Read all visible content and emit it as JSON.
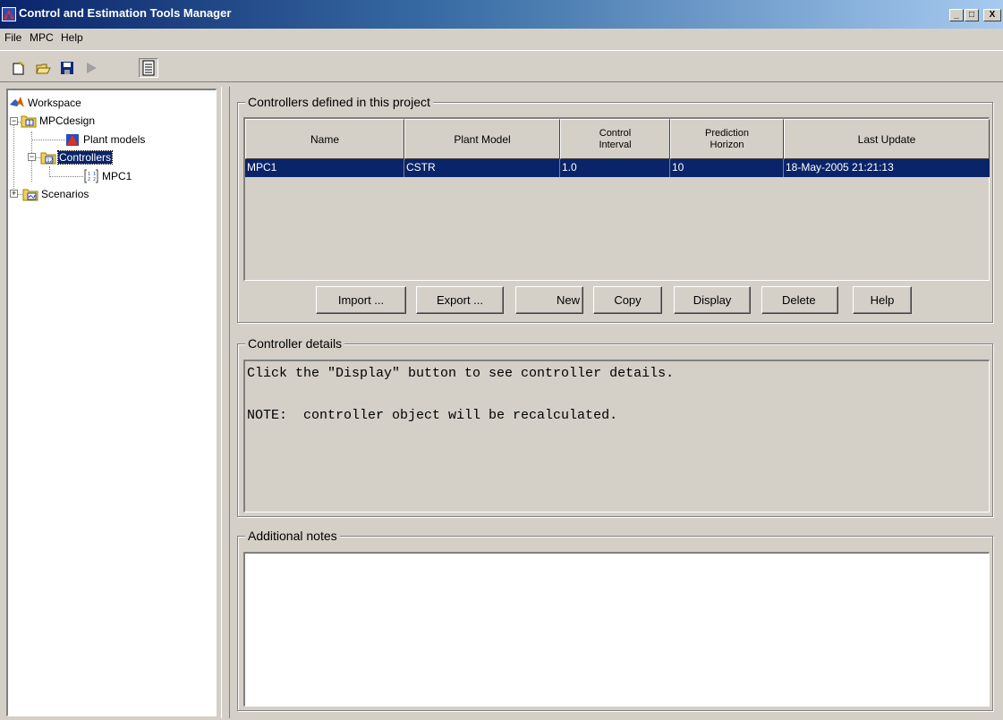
{
  "window": {
    "title": "Control and Estimation Tools Manager",
    "buttons": {
      "minimize": "_",
      "maximize": "□",
      "close": "X"
    }
  },
  "menu": [
    "File",
    "MPC",
    "Help"
  ],
  "toolbar": {
    "icons": [
      "new-icon",
      "open-icon",
      "save-icon",
      "run-icon",
      "notes-icon"
    ]
  },
  "tree": {
    "nodes": [
      {
        "label": "Workspace",
        "icon": "matlab-icon"
      },
      {
        "label": "MPCdesign",
        "icon": "project-icon",
        "expander": "−"
      },
      {
        "label": "Plant models",
        "icon": "plant-icon"
      },
      {
        "label": "Controllers",
        "icon": "controllers-icon",
        "expander": "−",
        "selected": true
      },
      {
        "label": "MPC1",
        "icon": "controller-icon"
      },
      {
        "label": "Scenarios",
        "icon": "scenarios-icon",
        "expander": "+"
      }
    ]
  },
  "controllers": {
    "title": "Controllers defined in this project",
    "columns": [
      "Name",
      "Plant Model",
      "Control\nInterval",
      "Prediction\nHorizon",
      "Last Update"
    ],
    "rows": [
      [
        "MPC1",
        "CSTR",
        "1.0",
        "10",
        "18-May-2005 21:21:13"
      ]
    ],
    "buttons": {
      "import": "Import ...",
      "export": "Export ...",
      "new": "New",
      "copy": "Copy",
      "display": "Display",
      "delete": "Delete",
      "help": "Help"
    }
  },
  "details": {
    "title": "Controller details",
    "line1": "Click the \"Display\" button to see controller details.",
    "line2": "NOTE:  controller object will be recalculated."
  },
  "notes": {
    "title": "Additional notes",
    "value": ""
  },
  "colors": {
    "selection": "#0a246a",
    "face": "#d4d0c8",
    "title_gradient_start": "#0a246a",
    "title_gradient_end": "#a6caf0"
  }
}
